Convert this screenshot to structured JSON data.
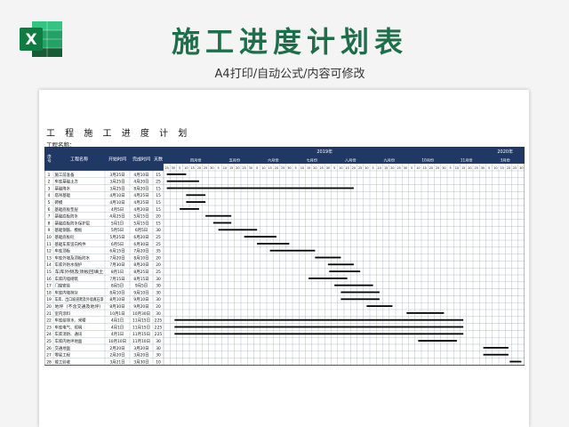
{
  "banner": {
    "title": "施工进度计划表",
    "subtitle": "A4打印/自动公式/内容可修改",
    "logo_letter": "X",
    "logo_icon": "excel-icon",
    "brand_color": "#1f6e4a"
  },
  "sheet": {
    "title": "工 程 施 工 进 度 计 划",
    "project_label": "工程名称：",
    "header": {
      "seq": "序号",
      "name": "工程名称",
      "start": "开始时间",
      "end": "完成时间",
      "days": "天数",
      "year_2019": "2019年",
      "year_2020": "2020年"
    },
    "months": [
      "四月份",
      "五月份",
      "六月份",
      "七月份",
      "八月份",
      "九月份",
      "10月份",
      "11月份",
      "3月份"
    ],
    "day_ticks": [
      "25",
      "30",
      "5",
      "10",
      "15",
      "20",
      "25",
      "30"
    ],
    "tasks": [
      {
        "no": "1",
        "name": "施工前准备",
        "start": "3月25日",
        "end": "4月10日",
        "days": "15"
      },
      {
        "no": "2",
        "name": "车库基础土方",
        "start": "3月25日",
        "end": "4月20日",
        "days": "25"
      },
      {
        "no": "3",
        "name": "基础降水",
        "start": "3月25日",
        "end": "8月20日",
        "days": "15"
      },
      {
        "no": "4",
        "name": "塔吊基础",
        "start": "4月10日",
        "end": "4月25日",
        "days": "15"
      },
      {
        "no": "5",
        "name": "砖模",
        "start": "4月10日",
        "end": "4月25日",
        "days": "15"
      },
      {
        "no": "6",
        "name": "基础底板垫层",
        "start": "4月5日",
        "end": "4月20日",
        "days": "15"
      },
      {
        "no": "7",
        "name": "基础底板防水",
        "start": "4月25日",
        "end": "5月15日",
        "days": "20"
      },
      {
        "no": "8",
        "name": "基础底板防水保护层",
        "start": "5月1日",
        "end": "5月15日",
        "days": "15"
      },
      {
        "no": "9",
        "name": "基础钢筋、模板",
        "start": "5月5日",
        "end": "6月5日",
        "days": "30"
      },
      {
        "no": "10",
        "name": "基础底板砼",
        "start": "5月25日",
        "end": "6月20日",
        "days": "25"
      },
      {
        "no": "11",
        "name": "基础车库竖向构件",
        "start": "6月5日",
        "end": "6月30日",
        "days": "25"
      },
      {
        "no": "12",
        "name": "车库顶板",
        "start": "6月15日",
        "end": "7月20日",
        "days": "35"
      },
      {
        "no": "13",
        "name": "车库外墙及顶板防水",
        "start": "7月20日",
        "end": "8月10日",
        "days": "20"
      },
      {
        "no": "14",
        "name": "车库外防水保护",
        "start": "7月30日",
        "end": "8月20日",
        "days": "20"
      },
      {
        "no": "15",
        "name": "车库外侧及顶板回填土",
        "start": "8月1日",
        "end": "8月25日",
        "days": "25"
      },
      {
        "no": "16",
        "name": "车库内墙砌筑",
        "start": "7月15日",
        "end": "8月15日",
        "days": "30"
      },
      {
        "no": "17",
        "name": "门窗安装",
        "start": "8月5日",
        "end": "9月5日",
        "days": "30"
      },
      {
        "no": "18",
        "name": "车库内墙抹灰",
        "start": "8月10日",
        "end": "9月10日",
        "days": "30"
      },
      {
        "no": "19",
        "name": "车库、出口坡道爬及外墙真石漆",
        "start": "8月10日",
        "end": "9月10日",
        "days": "30"
      },
      {
        "no": "20",
        "name": "地坪（不含交通及地坪）",
        "start": "8月30日",
        "end": "9月20日",
        "days": "20"
      },
      {
        "no": "21",
        "name": "室内涂料",
        "start": "10月1日",
        "end": "10月30日",
        "days": "30"
      },
      {
        "no": "22",
        "name": "车库给排水、采暖",
        "start": "4月1日",
        "end": "11月15日",
        "days": "225"
      },
      {
        "no": "23",
        "name": "车库电气、照明",
        "start": "4月1日",
        "end": "11月15日",
        "days": "225"
      },
      {
        "no": "24",
        "name": "车库消防、通讯",
        "start": "4月1日",
        "end": "11月15日",
        "days": "225"
      },
      {
        "no": "25",
        "name": "车库内地坪地面",
        "start": "10月10日",
        "end": "11月10日",
        "days": "30"
      },
      {
        "no": "26",
        "name": "交通地面",
        "start": "2月20日",
        "end": "3月20日",
        "days": "30"
      },
      {
        "no": "27",
        "name": "零星工程",
        "start": "2月20日",
        "end": "3月20日",
        "days": "30"
      },
      {
        "no": "28",
        "name": "竣工验收",
        "start": "3月21日",
        "end": "3月30日",
        "days": "10"
      }
    ],
    "header_color": "#1f3864",
    "bar_color": "#000000"
  }
}
